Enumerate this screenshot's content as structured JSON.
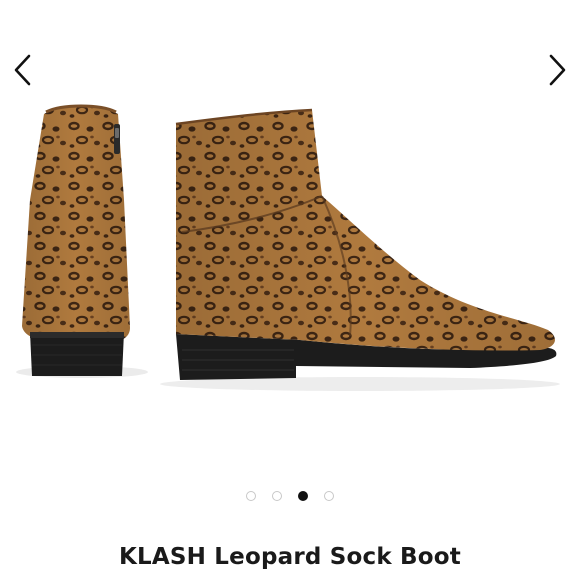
{
  "product": {
    "title": "KLASH Leopard Sock Boot"
  },
  "carousel": {
    "prev_icon": "chevron-left-icon",
    "next_icon": "chevron-right-icon",
    "image_count": 4,
    "active_index": 2
  },
  "colors": {
    "leopard_base": "#b07a3e",
    "leopard_spot": "#3e2614",
    "sole": "#1c1c1c",
    "dot_active": "#111111",
    "dot_inactive": "#c8c8c8"
  }
}
